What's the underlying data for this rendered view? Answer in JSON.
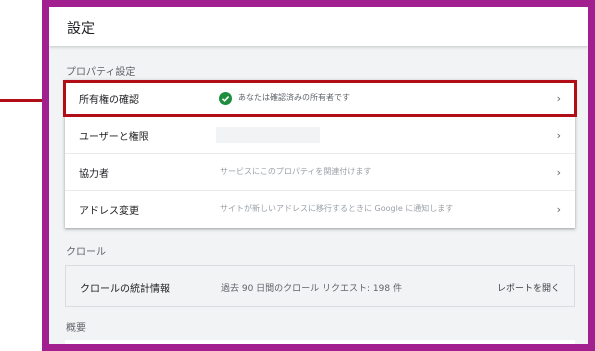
{
  "header": {
    "title": "設定"
  },
  "sections": {
    "property_settings": "プロパティ設定",
    "crawl": "クロール",
    "overview": "概要"
  },
  "rows": [
    {
      "label": "所有権の確認",
      "description": "あなたは確認済みの所有者です"
    },
    {
      "label": "ユーザーと権限",
      "description": ""
    },
    {
      "label": "協力者",
      "description": "サービスにこのプロパティを関連付けます"
    },
    {
      "label": "アドレス変更",
      "description": "サイトが新しいアドレスに移行するときに Google に通知します"
    }
  ],
  "crawl": {
    "label": "クロールの統計情報",
    "description": "過去 90 日間のクロール リクエスト: 198 件",
    "link": "レポートを開く"
  },
  "chevron": "›",
  "colors": {
    "annotation_red": "#b10d16",
    "frame_purple": "#a11f8f",
    "success_green": "#1e8e3e"
  },
  "icons": [
    "check-circle-icon",
    "chevron-right-icon",
    "annotation-arrow"
  ]
}
